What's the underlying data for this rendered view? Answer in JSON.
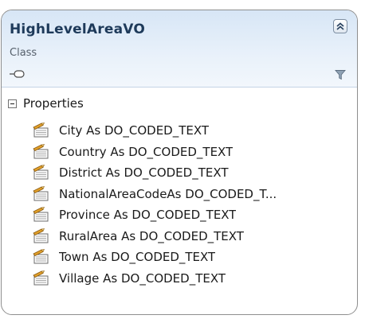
{
  "class_shape": {
    "name": "HighLevelAreaVO",
    "stereotype": "Class",
    "colors": {
      "header_top": "#d7e6f6",
      "header_bottom": "#f2f7fc",
      "border": "#8e8e8e",
      "title": "#1e3a5a"
    },
    "icons": {
      "collapse": "double-chevron-up-icon",
      "interface": "lollipop-interface-icon",
      "filter": "funnel-filter-icon",
      "property": "property-icon"
    }
  },
  "compartment": {
    "title": "Properties",
    "items": [
      "City As DO_CODED_TEXT",
      "Country As DO_CODED_TEXT",
      "District As DO_CODED_TEXT",
      "NationalAreaCodeAs DO_CODED_T...",
      "Province As DO_CODED_TEXT",
      "RuralArea As DO_CODED_TEXT",
      "Town As DO_CODED_TEXT",
      "Village As DO_CODED_TEXT"
    ]
  }
}
